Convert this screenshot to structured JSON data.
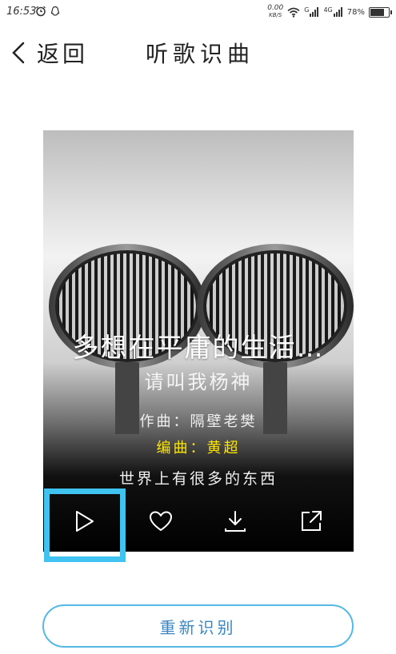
{
  "status_bar": {
    "time": "16:53",
    "net_speed": "0.00",
    "net_unit": "KB/S",
    "sim1": "G",
    "sim2": "4G",
    "battery": "78%",
    "battery_level": 0.78
  },
  "header": {
    "back_label": "返回",
    "title": "听歌识曲"
  },
  "song": {
    "title": "多想在平庸的生活…",
    "artist": "请叫我杨神",
    "composer": "作曲：隔壁老樊",
    "arranger": "编曲：黄超",
    "lyric": "世界上有很多的东西"
  },
  "controls": {
    "icons": [
      "play-icon",
      "heart-icon",
      "download-icon",
      "share-icon"
    ]
  },
  "colors": {
    "highlight": "#3fc3f0",
    "button_border": "#56b8e6",
    "button_text": "#3a86c2",
    "arranger_text": "#ffe600"
  },
  "actions": {
    "rerecognize_label": "重新识别"
  }
}
